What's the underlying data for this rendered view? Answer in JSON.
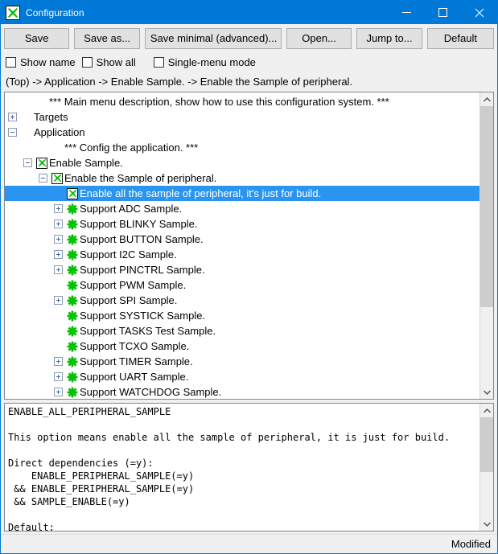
{
  "window": {
    "title": "Configuration",
    "icon": "green-x-checkbox-icon",
    "accent_color": "#0078d7",
    "minimize_label": "Minimize",
    "maximize_label": "Maximize",
    "close_label": "Close"
  },
  "toolbar": {
    "buttons": [
      {
        "label": "Save",
        "name": "save-button"
      },
      {
        "label": "Save as...",
        "name": "save-as-button"
      },
      {
        "label": "Save minimal (advanced)...",
        "name": "save-minimal-button"
      },
      {
        "label": "Open...",
        "name": "open-button"
      },
      {
        "label": "Jump to...",
        "name": "jump-to-button"
      },
      {
        "label": "Default",
        "name": "default-button"
      }
    ]
  },
  "options": {
    "checkboxes": [
      {
        "label": "Show name",
        "checked": false,
        "name": "show-name-checkbox"
      },
      {
        "label": "Show all",
        "checked": false,
        "name": "show-all-checkbox"
      },
      {
        "label": "Single-menu mode",
        "checked": false,
        "name": "single-menu-mode-checkbox"
      }
    ]
  },
  "breadcrumb": {
    "text": "(Top) -> Application -> Enable Sample. -> Enable the Sample of peripheral."
  },
  "tree": {
    "selection_color": "#2a95f0",
    "icon_color": "#00c000",
    "rows": [
      {
        "indent": 1,
        "twist": "none",
        "icon": "none",
        "label": "*** Main menu description, show how to use this configuration system. ***",
        "selected": false
      },
      {
        "indent": 0,
        "twist": "plus",
        "icon": "none",
        "label": "Targets",
        "selected": false
      },
      {
        "indent": 0,
        "twist": "minus",
        "icon": "none",
        "label": "Application",
        "selected": false
      },
      {
        "indent": 2,
        "twist": "none",
        "icon": "none",
        "label": "*** Config the application. ***",
        "selected": false
      },
      {
        "indent": 1,
        "twist": "minus",
        "icon": "check",
        "label": "Enable Sample.",
        "selected": false
      },
      {
        "indent": 2,
        "twist": "minus",
        "icon": "check",
        "label": "Enable the Sample of peripheral.",
        "selected": false
      },
      {
        "indent": 3,
        "twist": "none",
        "icon": "check",
        "label": "Enable all the sample of peripheral, it's just for build.",
        "selected": true
      },
      {
        "indent": 3,
        "twist": "plus",
        "icon": "star",
        "label": "Support ADC Sample.",
        "selected": false
      },
      {
        "indent": 3,
        "twist": "plus",
        "icon": "star",
        "label": "Support BLINKY Sample.",
        "selected": false
      },
      {
        "indent": 3,
        "twist": "plus",
        "icon": "star",
        "label": "Support BUTTON Sample.",
        "selected": false
      },
      {
        "indent": 3,
        "twist": "plus",
        "icon": "star",
        "label": "Support I2C Sample.",
        "selected": false
      },
      {
        "indent": 3,
        "twist": "plus",
        "icon": "star",
        "label": "Support PINCTRL Sample.",
        "selected": false
      },
      {
        "indent": 3,
        "twist": "none",
        "icon": "star",
        "label": "Support PWM Sample.",
        "selected": false
      },
      {
        "indent": 3,
        "twist": "plus",
        "icon": "star",
        "label": "Support SPI Sample.",
        "selected": false
      },
      {
        "indent": 3,
        "twist": "none",
        "icon": "star",
        "label": "Support SYSTICK Sample.",
        "selected": false
      },
      {
        "indent": 3,
        "twist": "none",
        "icon": "star",
        "label": "Support TASKS Test Sample.",
        "selected": false
      },
      {
        "indent": 3,
        "twist": "none",
        "icon": "star",
        "label": "Support TCXO Sample.",
        "selected": false
      },
      {
        "indent": 3,
        "twist": "plus",
        "icon": "star",
        "label": "Support TIMER Sample.",
        "selected": false
      },
      {
        "indent": 3,
        "twist": "plus",
        "icon": "star",
        "label": "Support UART Sample.",
        "selected": false
      },
      {
        "indent": 3,
        "twist": "plus",
        "icon": "star",
        "label": "Support WATCHDOG Sample.",
        "selected": false
      }
    ]
  },
  "detail": {
    "text": "ENABLE_ALL_PERIPHERAL_SAMPLE\n\nThis option means enable all the sample of peripheral, it is just for build.\n\nDirect dependencies (=y):\n    ENABLE_PERIPHERAL_SAMPLE(=y)\n && ENABLE_PERIPHERAL_SAMPLE(=y)\n && SAMPLE_ENABLE(=y)\n\nDefault:\n  - n"
  },
  "status": {
    "text": "Modified"
  }
}
